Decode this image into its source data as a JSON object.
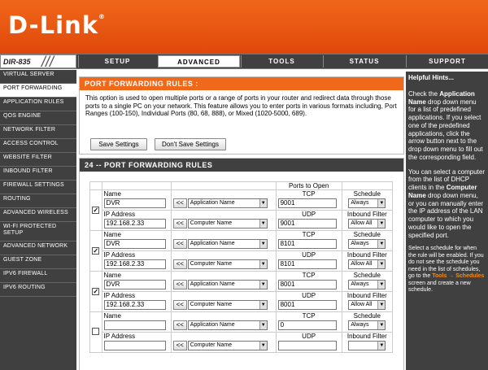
{
  "brand": {
    "logo": "D-Link",
    "trademark": "®"
  },
  "model": "DIR-835",
  "nav": {
    "tabs": [
      "SETUP",
      "ADVANCED",
      "TOOLS",
      "STATUS",
      "SUPPORT"
    ],
    "active_tab": "ADVANCED"
  },
  "sidebar": {
    "items": [
      {
        "label": "VIRTUAL SERVER"
      },
      {
        "label": "PORT FORWARDING"
      },
      {
        "label": "APPLICATION RULES"
      },
      {
        "label": "QOS ENGINE"
      },
      {
        "label": "NETWORK FILTER"
      },
      {
        "label": "ACCESS CONTROL"
      },
      {
        "label": "WEBSITE FILTER"
      },
      {
        "label": "INBOUND FILTER"
      },
      {
        "label": "FIREWALL SETTINGS"
      },
      {
        "label": "ROUTING"
      },
      {
        "label": "ADVANCED WIRELESS"
      },
      {
        "label": "WI-FI PROTECTED SETUP"
      },
      {
        "label": "ADVANCED NETWORK"
      },
      {
        "label": "GUEST ZONE"
      },
      {
        "label": "IPV6 FIREWALL"
      },
      {
        "label": "IPV6 ROUTING"
      }
    ],
    "active": "PORT FORWARDING"
  },
  "rules_section": {
    "title": "PORT FORWARDING RULES :",
    "intro": "This option is used to open multiple ports or a range of ports in your router and redirect data through those ports to a single PC on your network. This feature allows you to enter ports in various formats including, Port Ranges (100-150), Individual Ports (80, 68, 888), or Mixed (1020-5000, 689).",
    "save_label": "Save Settings",
    "dont_save_label": "Don't Save Settings"
  },
  "table": {
    "title": "24 -- PORT FORWARDING RULES",
    "ports_header": "Ports to Open",
    "name_label": "Name",
    "ip_label": "IP Address",
    "tcp_label": "TCP",
    "udp_label": "UDP",
    "schedule_label": "Schedule",
    "inbound_label": "Inbound Filter",
    "chevron": "<<",
    "app_select": "Application Name",
    "computer_select": "Computer Name",
    "rows": [
      {
        "checked": true,
        "name": "DVR",
        "ip": "192.168.2.33",
        "tcp": "9001",
        "udp": "9001",
        "schedule": "Always",
        "inbound": "Allow All",
        "check_mark": "✓"
      },
      {
        "checked": true,
        "name": "DVR",
        "ip": "192.168.2.33",
        "tcp": "8101",
        "udp": "8101",
        "schedule": "Always",
        "inbound": "Allow All",
        "check_mark": "✓"
      },
      {
        "checked": true,
        "name": "DVR",
        "ip": "192.168.2.33",
        "tcp": "8001",
        "udp": "8001",
        "schedule": "Always",
        "inbound": "Allow All",
        "check_mark": "✓"
      },
      {
        "checked": false,
        "name": "",
        "ip": "",
        "tcp": "0",
        "udp": "",
        "schedule": "Always",
        "inbound": "",
        "check_mark": ""
      }
    ]
  },
  "hints": {
    "title": "Helpful Hints...",
    "p1_a": "Check the",
    "p1_b": "Application Name",
    "p1_c": "drop down menu for a list of predefined applications. If you select one of the predefined applications, click the arrow button next to the drop down menu to fill out the corresponding field.",
    "p2_a": "You can select a computer from the list of DHCP clients in the",
    "p2_b": "Computer Name",
    "p2_c": "drop down menu, or you can manually enter the IP address of the LAN computer to which you would like to open the specified port.",
    "p3_a": "Select a schedule for when the rule will be enabled. If you do not see the schedule you need in the list of schedules, go to the",
    "p3_link": "Tools → Schedules",
    "p3_b": "screen and create a new schedule."
  },
  "colors": {
    "accent": "#f0691b",
    "nav_bg": "#404040",
    "hint_link": "#f08a1c"
  }
}
